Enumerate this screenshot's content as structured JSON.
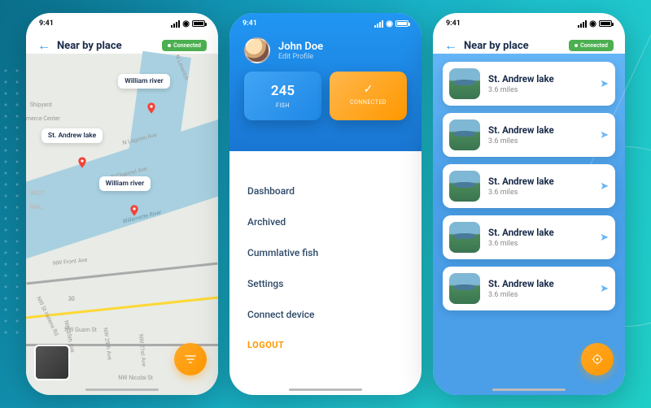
{
  "status": {
    "time": "9:41"
  },
  "screen1": {
    "title": "Near by place",
    "badge": "Connected",
    "pins": [
      {
        "label": "William river"
      },
      {
        "label": "St. Andrew lake"
      },
      {
        "label": "William river"
      }
    ],
    "map_text": {
      "shipyard": "Shipyard",
      "merce": "merce Center",
      "lagoon": "N Lagoon Ave",
      "channel": "N Channel Ave",
      "river": "Willamette River",
      "front": "NW Front Ave",
      "guam": "NW Guam St",
      "nicolai": "NW Nicolai St",
      "west": "WEST",
      "rial": "RIAL",
      "hwy": "30",
      "sthelens": "NW St Helens Rd",
      "nw35": "NW 35th Ave",
      "nw29": "NW 29th Ave",
      "nw21": "NW 21st Ave",
      "leverich": "N Leverich"
    }
  },
  "screen2": {
    "user": {
      "name": "John Doe",
      "sub": "Edit Profile"
    },
    "stats": [
      {
        "value": "245",
        "label": "FISH"
      },
      {
        "label": "CONNECTED"
      }
    ],
    "menu": [
      "Dashboard",
      "Archived",
      "Cummlative fish",
      "Settings",
      "Connect device"
    ],
    "logout": "LOGOUT"
  },
  "screen3": {
    "title": "Near by place",
    "badge": "Connected",
    "places": [
      {
        "name": "St. Andrew lake",
        "dist": "3.6 miles"
      },
      {
        "name": "St. Andrew lake",
        "dist": "3.6 miles"
      },
      {
        "name": "St. Andrew lake",
        "dist": "3.6 miles"
      },
      {
        "name": "St. Andrew lake",
        "dist": "3.6 miles"
      },
      {
        "name": "St. Andrew lake",
        "dist": "3.6 miles"
      }
    ]
  }
}
